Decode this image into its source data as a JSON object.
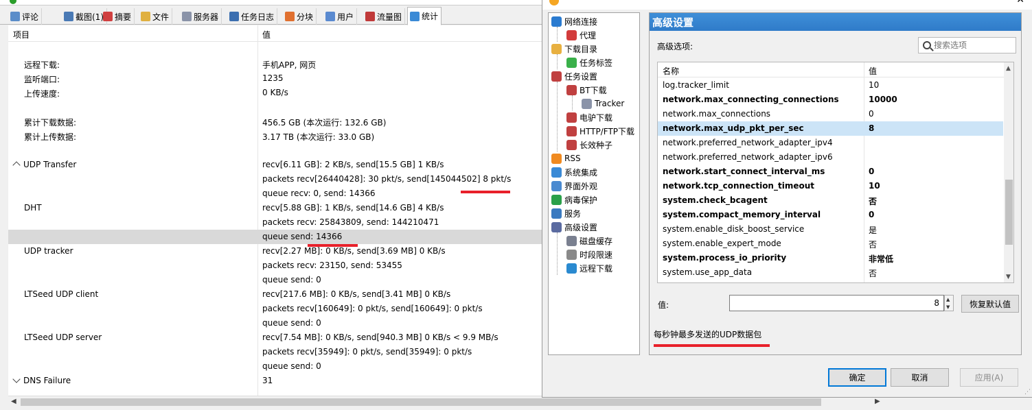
{
  "main": {
    "tabs": [
      {
        "label": "评论",
        "color": "#5b8dc9"
      },
      {
        "label": "截图(1)",
        "color": "#4a7ab5"
      },
      {
        "label": "摘要",
        "color": "#d04040"
      },
      {
        "label": "文件",
        "color": "#e0b040"
      },
      {
        "label": "服务器",
        "color": "#8a93a8"
      },
      {
        "label": "任务日志",
        "color": "#3c6fb0"
      },
      {
        "label": "分块",
        "color": "#e07030"
      },
      {
        "label": "用户",
        "color": "#5a8ad0"
      },
      {
        "label": "流量图",
        "color": "#c03a3a"
      },
      {
        "label": "统计",
        "color": "#3a8ad6"
      }
    ],
    "grid": {
      "header_key": "项目",
      "header_value": "值",
      "rows": [
        {
          "key": "远程下载:",
          "value": "手机APP, 网页"
        },
        {
          "key": "监听端口:",
          "value": "1235"
        },
        {
          "key": "上传速度:",
          "value": "0 KB/s"
        },
        {
          "key": "累计下载数据:",
          "value": "456.5 GB (本次运行: 132.6 GB)"
        },
        {
          "key": "累计上传数据:",
          "value": "3.17 TB (本次运行: 33.0 GB)"
        },
        {
          "key": "UDP Transfer",
          "value": "recv[6.11 GB]: 2 KB/s, send[15.5 GB] 1 KB/s"
        },
        {
          "key": "",
          "value": "packets recv[26440428]: 30 pkt/s, send[145044502] 8 pkt/s"
        },
        {
          "key": "",
          "value": "queue recv: 0, send: 14366"
        },
        {
          "key": "DHT",
          "value": "recv[5.88 GB]: 1 KB/s, send[14.6 GB] 4 KB/s"
        },
        {
          "key": "",
          "value": "packets recv: 25843809, send: 144210471"
        },
        {
          "key": "",
          "value": "queue send: 14366"
        },
        {
          "key": "UDP tracker",
          "value": "recv[2.27 MB]: 0 KB/s, send[3.69 MB] 0 KB/s"
        },
        {
          "key": "",
          "value": "packets recv: 23150, send: 53455"
        },
        {
          "key": "",
          "value": "queue send: 0"
        },
        {
          "key": "LTSeed UDP client",
          "value": "recv[217.6 MB]: 0 KB/s, send[3.41 MB] 0 KB/s"
        },
        {
          "key": "",
          "value": "packets recv[160649]: 0 pkt/s, send[160649]: 0 pkt/s"
        },
        {
          "key": "",
          "value": "queue send: 0"
        },
        {
          "key": "LTSeed UDP server",
          "value": "recv[7.54 MB]: 0 KB/s, send[940.3 MB] 0 KB/s < 9.9 MB/s"
        },
        {
          "key": "",
          "value": "packets recv[35949]: 0 pkt/s, send[35949]: 0 pkt/s"
        },
        {
          "key": "",
          "value": "queue send: 0"
        },
        {
          "key": "DNS Failure",
          "value": "31"
        }
      ]
    }
  },
  "dialog": {
    "tree": [
      {
        "label": "网络连接",
        "color": "#2a7bd0"
      },
      {
        "label": "代理",
        "color": "#d23c3c"
      },
      {
        "label": "下载目录",
        "color": "#e8b040"
      },
      {
        "label": "任务标签",
        "color": "#3ab04a"
      },
      {
        "label": "任务设置",
        "color": "#c04040"
      },
      {
        "label": "BT下载",
        "color": "#c04040"
      },
      {
        "label": "Tracker",
        "color": "#8a93a8"
      },
      {
        "label": "电驴下载",
        "color": "#c04040"
      },
      {
        "label": "HTTP/FTP下载",
        "color": "#c04040"
      },
      {
        "label": "长效种子",
        "color": "#c04040"
      },
      {
        "label": "RSS",
        "color": "#f08a20"
      },
      {
        "label": "系统集成",
        "color": "#3a8ad6"
      },
      {
        "label": "界面外观",
        "color": "#4a8ad0"
      },
      {
        "label": "病毒保护",
        "color": "#2aa04a"
      },
      {
        "label": "服务",
        "color": "#3a7ac0"
      },
      {
        "label": "高级设置",
        "color": "#5a6aa0"
      },
      {
        "label": "磁盘缓存",
        "color": "#7a8090"
      },
      {
        "label": "时段限速",
        "color": "#8a8a8a"
      },
      {
        "label": "远程下载",
        "color": "#2a8ad0"
      }
    ],
    "panel_title": "高级设置",
    "advanced_label": "高级选项:",
    "search_placeholder": "搜索选项",
    "options_header_name": "名称",
    "options_header_value": "值",
    "options": [
      {
        "name": "log.tracker_limit",
        "value": "10",
        "bold": false
      },
      {
        "name": "network.max_connecting_connections",
        "value": "10000",
        "bold": true
      },
      {
        "name": "network.max_connections",
        "value": "0",
        "bold": false
      },
      {
        "name": "network.max_udp_pkt_per_sec",
        "value": "8",
        "bold": true
      },
      {
        "name": "network.preferred_network_adapter_ipv4",
        "value": "",
        "bold": false
      },
      {
        "name": "network.preferred_network_adapter_ipv6",
        "value": "",
        "bold": false
      },
      {
        "name": "network.start_connect_interval_ms",
        "value": "0",
        "bold": true
      },
      {
        "name": "network.tcp_connection_timeout",
        "value": "10",
        "bold": true
      },
      {
        "name": "system.check_bcagent",
        "value": "否",
        "bold": true
      },
      {
        "name": "system.compact_memory_interval",
        "value": "0",
        "bold": true
      },
      {
        "name": "system.enable_disk_boost_service",
        "value": "是",
        "bold": false
      },
      {
        "name": "system.enable_expert_mode",
        "value": "否",
        "bold": false
      },
      {
        "name": "system.process_io_priority",
        "value": "非常低",
        "bold": true
      },
      {
        "name": "system.use_app_data",
        "value": "否",
        "bold": false
      }
    ],
    "value_label": "值:",
    "value_input": "8",
    "reset_label": "恢复默认值",
    "description": "每秒钟最多发送的UDP数据包",
    "ok_label": "确定",
    "cancel_label": "取消",
    "apply_label": "应用(A)"
  },
  "colors": {
    "accent": "#0078d7",
    "selection": "#cce4f7",
    "highlight_mark": "#e8202a",
    "panel_title": "#2f7bc9"
  }
}
